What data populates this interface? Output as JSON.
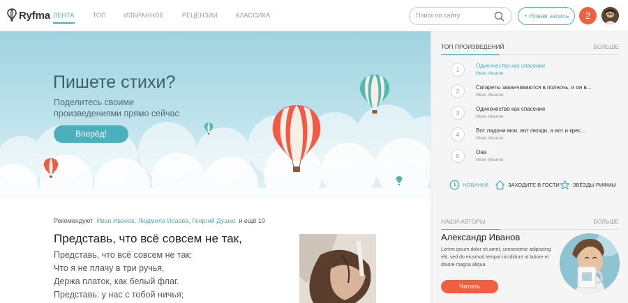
{
  "brand": {
    "name": "Ryfma"
  },
  "nav": [
    {
      "label": "ЛЕНТА",
      "active": true
    },
    {
      "label": "ТОП"
    },
    {
      "label": "ИЗБРАННОЕ"
    },
    {
      "label": "РЕЦЕНЗИИ"
    },
    {
      "label": "КЛАССИКА"
    }
  ],
  "search": {
    "placeholder": "Поиск по сайту",
    "value": ""
  },
  "header_actions": {
    "new_post": "+ Новая запись",
    "notifications": "2"
  },
  "hero": {
    "title": "Пишете стихи?",
    "subtitle": "Поделитесь своими произведениями прямо сейчас",
    "cta": "Вперёд!"
  },
  "feed": {
    "recommend_prefix": "Рекомендуют",
    "recommenders": [
      "Иван Иванов",
      "Людмила Исаева",
      "Георгий Душко"
    ],
    "recommend_suffix": "и ещё 10",
    "poem_title": "Представь, что всё совсем не так,",
    "poem_lines": [
      "Представь, что всё совсем не так:",
      "Что я не плачу в три ручья,",
      "Держа платок, как белый флаг.",
      "Представь: у нас с тобой ничья;"
    ]
  },
  "top_works": {
    "title": "ТОП ПРОИЗВЕДЕНИЙ",
    "more": "БОЛЬШЕ",
    "items": [
      {
        "num": "1",
        "title": "Одиночество как спасение",
        "author": "Иван Иванов",
        "active": true
      },
      {
        "num": "2",
        "title": "Сигареты заканчиваются в полночь, и он выходит покурить",
        "author": "Иван Иванов"
      },
      {
        "num": "3",
        "title": "Одиночество как спасение",
        "author": "Иван Иванов"
      },
      {
        "num": "4",
        "title": "Вот ладони мои, вот гвозди, а вот и крест",
        "author": "Иван Иванов"
      },
      {
        "num": "5",
        "title": "Она",
        "author": "Иван Иванов"
      }
    ]
  },
  "quick_links": [
    {
      "label": "НОВИНКИ",
      "icon": "clock-icon",
      "color": "#4ab0bc"
    },
    {
      "label": "ЗАХОДИТЕ В ГОСТИ",
      "icon": "home-icon",
      "color": "#333333"
    },
    {
      "label": "ЗВЁЗДЫ РИФМЫ",
      "icon": "star-icon",
      "color": "#333333"
    }
  ],
  "authors": {
    "title": "НАШИ АВТОРЫ",
    "more": "БОЛЬШЕ",
    "name": "Александр Иванов",
    "bio": "Lorem ipsum dolor sit amet, consectetur adipiscing elit, sed do eiusmod tempor incididunt ut labore et dolore magna aliqua",
    "cta": "Читать"
  },
  "colors": {
    "accent": "#4ab0bc",
    "primary_red": "#ef6040",
    "sidebar_bg": "#f5f5f5"
  }
}
